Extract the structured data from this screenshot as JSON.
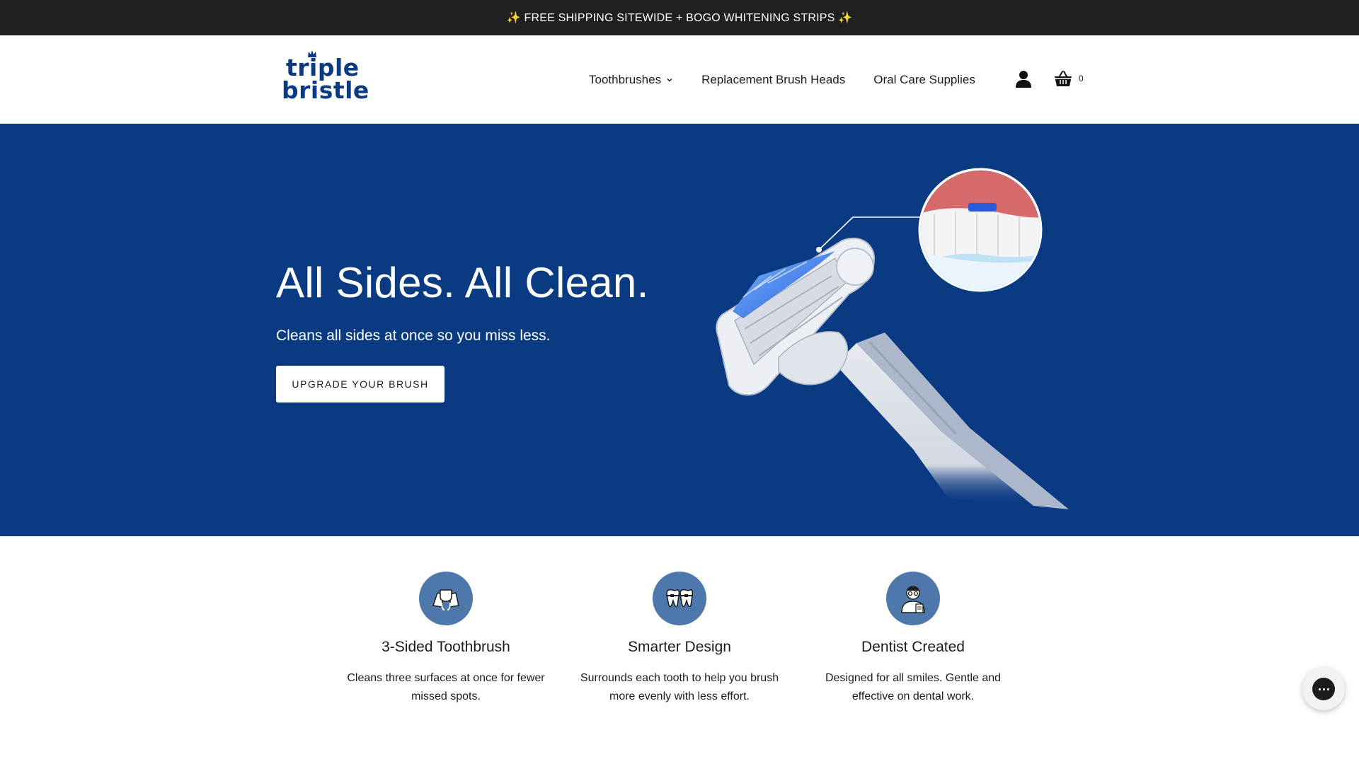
{
  "announcement": {
    "text": "✨ FREE SHIPPING SITEWIDE + BOGO WHITENING STRIPS ✨"
  },
  "header": {
    "logo": {
      "line1": "triple",
      "line2": "bristle"
    },
    "nav": [
      {
        "label": "Toothbrushes",
        "has_dropdown": true
      },
      {
        "label": "Replacement Brush Heads",
        "has_dropdown": false
      },
      {
        "label": "Oral Care Supplies",
        "has_dropdown": false
      }
    ],
    "account_icon": "user-icon",
    "cart": {
      "icon": "basket-icon",
      "count": "0"
    }
  },
  "hero": {
    "title": "All Sides. All Clean.",
    "subtitle": "Cleans all sides at once so you miss less.",
    "cta_label": "UPGRADE YOUR BRUSH"
  },
  "features": [
    {
      "icon": "three-sided-brush-icon",
      "title": "3-Sided Toothbrush",
      "text": "Cleans three surfaces at once for fewer missed spots."
    },
    {
      "icon": "teeth-braces-icon",
      "title": "Smarter Design",
      "text": "Surrounds each tooth to help you brush more evenly with less effort."
    },
    {
      "icon": "dentist-icon",
      "title": "Dentist Created",
      "text": "Designed for all smiles. Gentle and effective on dental work."
    }
  ],
  "chat": {
    "icon": "chat-icon"
  },
  "colors": {
    "brand_blue": "#0a3a82",
    "icon_circle": "#4e78ac",
    "announcement_bg": "#202020"
  }
}
